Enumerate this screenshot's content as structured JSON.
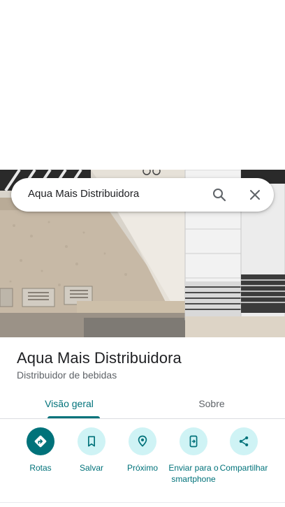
{
  "search": {
    "query": "Aqua Mais Distribuidora",
    "search_icon": "search-icon",
    "close_icon": "close-icon"
  },
  "hero": {
    "image": "storefront-photo"
  },
  "place": {
    "name": "Aqua Mais Distribuidora",
    "category": "Distribuidor de bebidas"
  },
  "tabs": [
    {
      "label": "Visão geral",
      "active": true
    },
    {
      "label": "Sobre",
      "active": false
    }
  ],
  "actions": [
    {
      "label": "Rotas",
      "icon": "directions-icon",
      "primary": true
    },
    {
      "label": "Salvar",
      "icon": "bookmark-icon",
      "primary": false
    },
    {
      "label": "Próximo",
      "icon": "nearby-icon",
      "primary": false
    },
    {
      "label": "Enviar para o smartphone",
      "icon": "send-to-phone-icon",
      "primary": false
    },
    {
      "label": "Compartilhar",
      "icon": "share-icon",
      "primary": false
    }
  ],
  "colors": {
    "accent": "#00727a",
    "action_bg": "#cff3f5"
  }
}
